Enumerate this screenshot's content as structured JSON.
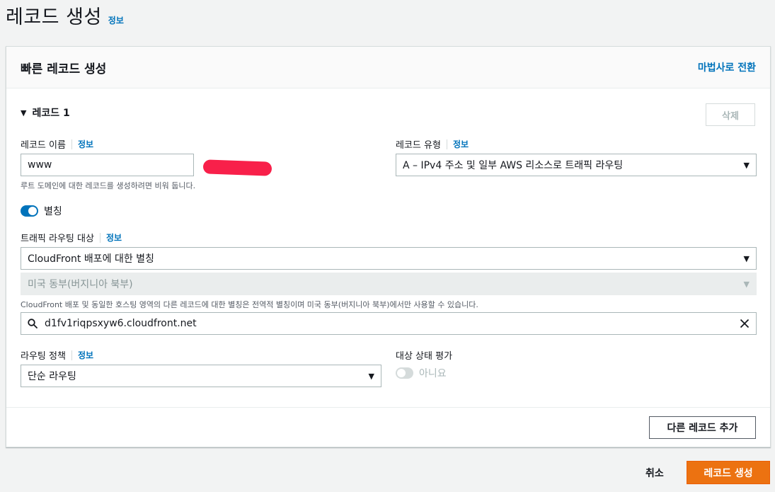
{
  "header": {
    "title": "레코드 생성",
    "info": "정보"
  },
  "panel": {
    "title": "빠른 레코드 생성",
    "wizard_link": "마법사로 전환",
    "record_section": "레코드 1",
    "delete_button": "삭제",
    "record_name": {
      "label": "레코드 이름",
      "info": "정보",
      "value": "www",
      "hint": "루트 도메인에 대한 레코드를 생성하려면 비워 둡니다."
    },
    "record_type": {
      "label": "레코드 유형",
      "info": "정보",
      "value": "A – IPv4 주소 및 일부 AWS 리소스로 트래픽 라우팅"
    },
    "alias": {
      "label": "별칭",
      "enabled": true
    },
    "route_target": {
      "label": "트래픽 라우팅 대상",
      "info": "정보",
      "endpoint": "CloudFront 배포에 대한 별칭",
      "region": "미국 동부(버지니아 북부)",
      "hint": "CloudFront 배포 및 동일한 호스팅 영역의 다른 레코드에 대한 별칭은 전역적 별칭이며 미국 동부(버지니아 북부)에서만 사용할 수 있습니다.",
      "search_value": "d1fv1riqpsxyw6.cloudfront.net"
    },
    "routing_policy": {
      "label": "라우팅 정책",
      "info": "정보",
      "value": "단순 라우팅"
    },
    "health_check": {
      "label": "대상 상태 평가",
      "value": "아니요",
      "enabled": false
    },
    "add_button": "다른 레코드 추가"
  },
  "footer": {
    "cancel": "취소",
    "create": "레코드 생성"
  },
  "colors": {
    "accent": "#0073bb",
    "primary_button": "#ec7211",
    "redaction": "#f8204a"
  }
}
